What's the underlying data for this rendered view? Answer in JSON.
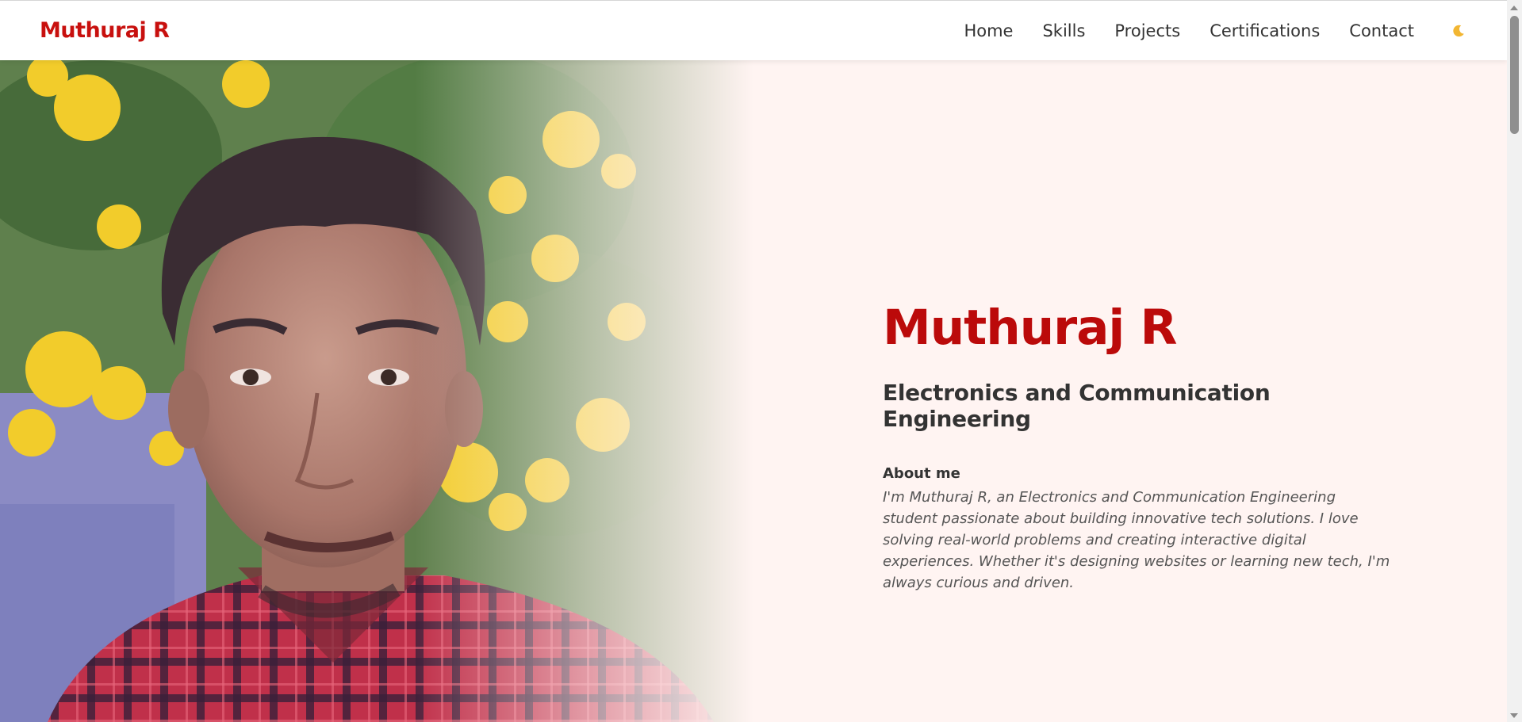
{
  "navbar": {
    "brand": "Muthuraj R",
    "links": [
      "Home",
      "Skills",
      "Projects",
      "Certifications",
      "Contact"
    ],
    "theme_toggle_icon": "moon-icon"
  },
  "hero": {
    "name": "Muthuraj R",
    "subtitle": "Electronics and Communication Engineering",
    "about_heading": "About me",
    "about_text": "I'm Muthuraj R, an Electronics and Communication Engineering student passionate about building innovative tech solutions. I love solving real-world problems and creating interactive digital experiences. Whether it's designing websites or learning new tech, I'm always curious and driven."
  },
  "colors": {
    "accent": "#c8100e",
    "hero_background": "#fff4f2",
    "text_dark": "#333333",
    "text_muted": "#555555"
  }
}
